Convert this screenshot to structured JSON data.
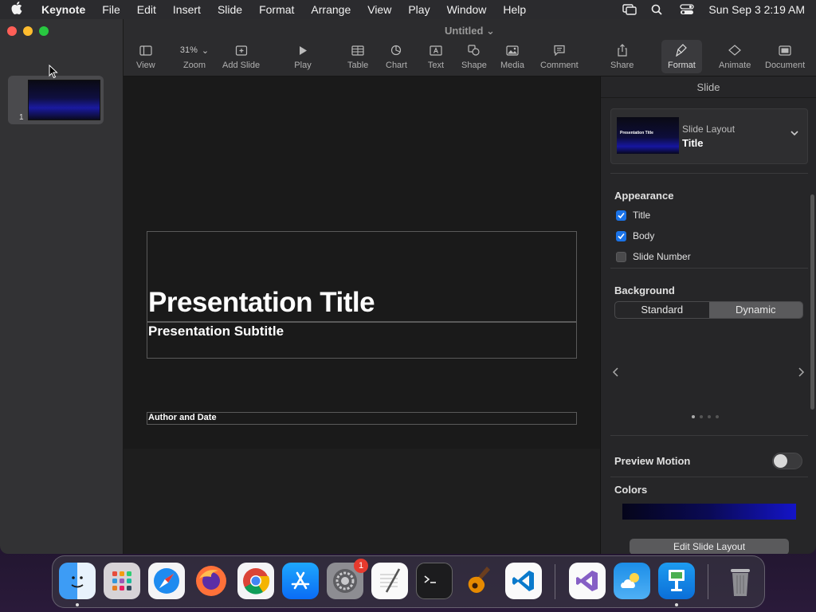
{
  "menubar": {
    "app_name": "Keynote",
    "menus": [
      "File",
      "Edit",
      "Insert",
      "Slide",
      "Format",
      "Arrange",
      "View",
      "Play",
      "Window",
      "Help"
    ],
    "datetime": "Sun Sep 3  2:19 AM"
  },
  "window": {
    "title": "Untitled",
    "toolbar": {
      "view": "View",
      "zoom_value": "31%",
      "zoom": "Zoom",
      "add_slide": "Add Slide",
      "play": "Play",
      "table": "Table",
      "chart": "Chart",
      "text": "Text",
      "shape": "Shape",
      "media": "Media",
      "comment": "Comment",
      "share": "Share",
      "format": "Format",
      "animate": "Animate",
      "document": "Document"
    }
  },
  "navigator": {
    "slides": [
      {
        "number": "1"
      }
    ]
  },
  "slide": {
    "title": "Presentation Title",
    "subtitle": "Presentation Subtitle",
    "author": "Author and Date"
  },
  "inspector": {
    "header": "Slide",
    "layout_label": "Slide Layout",
    "layout_value": "Title",
    "layout_thumb_title": "Presentation Title",
    "appearance_title": "Appearance",
    "appearance": {
      "title": {
        "label": "Title",
        "checked": true
      },
      "body": {
        "label": "Body",
        "checked": true
      },
      "slide_number": {
        "label": "Slide Number",
        "checked": false
      }
    },
    "background_title": "Background",
    "background_options": [
      "Standard",
      "Dynamic"
    ],
    "background_selected": "Dynamic",
    "preview_motion": "Preview Motion",
    "preview_motion_on": false,
    "colors_title": "Colors",
    "edit_layout_button": "Edit Slide Layout"
  },
  "dock": {
    "system_settings_badge": "1"
  },
  "colors": {
    "accent": "#1a73e8",
    "traffic_close": "#ff5f57",
    "traffic_min": "#febc2e",
    "traffic_max": "#28c840"
  }
}
